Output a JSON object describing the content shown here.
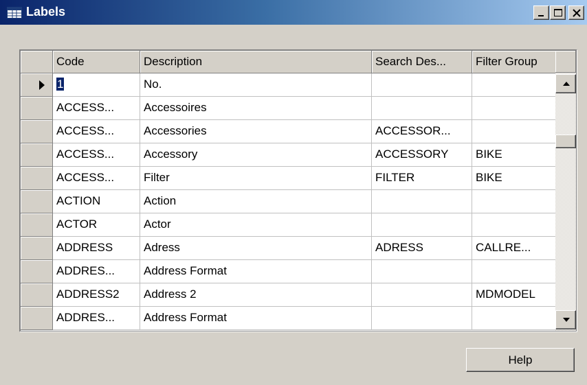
{
  "window": {
    "title": "Labels",
    "icon": "table-icon",
    "controls": [
      "minimize-icon",
      "maximize-icon",
      "close-icon"
    ]
  },
  "grid": {
    "columns": [
      "Code",
      "Description",
      "Search Des...",
      "Filter Group"
    ],
    "rows": [
      {
        "code": "1",
        "description": "No.",
        "search": "",
        "filter": ""
      },
      {
        "code": "ACCESS...",
        "description": "Accessoires",
        "search": "",
        "filter": ""
      },
      {
        "code": "ACCESS...",
        "description": "Accessories",
        "search": "ACCESSOR...",
        "filter": ""
      },
      {
        "code": "ACCESS...",
        "description": "Accessory",
        "search": "ACCESSORY",
        "filter": "BIKE"
      },
      {
        "code": "ACCESS...",
        "description": "Filter",
        "search": "FILTER",
        "filter": "BIKE"
      },
      {
        "code": "ACTION",
        "description": "Action",
        "search": "",
        "filter": ""
      },
      {
        "code": "ACTOR",
        "description": "Actor",
        "search": "",
        "filter": ""
      },
      {
        "code": "ADDRESS",
        "description": "Adress",
        "search": "ADRESS",
        "filter": "CALLRE..."
      },
      {
        "code": "ADDRES...",
        "description": "Address Format",
        "search": "",
        "filter": ""
      },
      {
        "code": "ADDRESS2",
        "description": "Address 2",
        "search": "",
        "filter": "MDMODEL"
      },
      {
        "code": "ADDRES...",
        "description": "Address Format",
        "search": "",
        "filter": ""
      }
    ],
    "current_row_marker": "row-pointer-icon",
    "scrollbar": {
      "up": "arrow-up-icon",
      "down": "arrow-down-icon"
    }
  },
  "footer": {
    "help_label": "Help"
  },
  "colors": {
    "title_gradient_start": "#0a246a",
    "title_gradient_end": "#a6caf0",
    "face": "#d4d0c8",
    "selection": "#0a246a"
  }
}
